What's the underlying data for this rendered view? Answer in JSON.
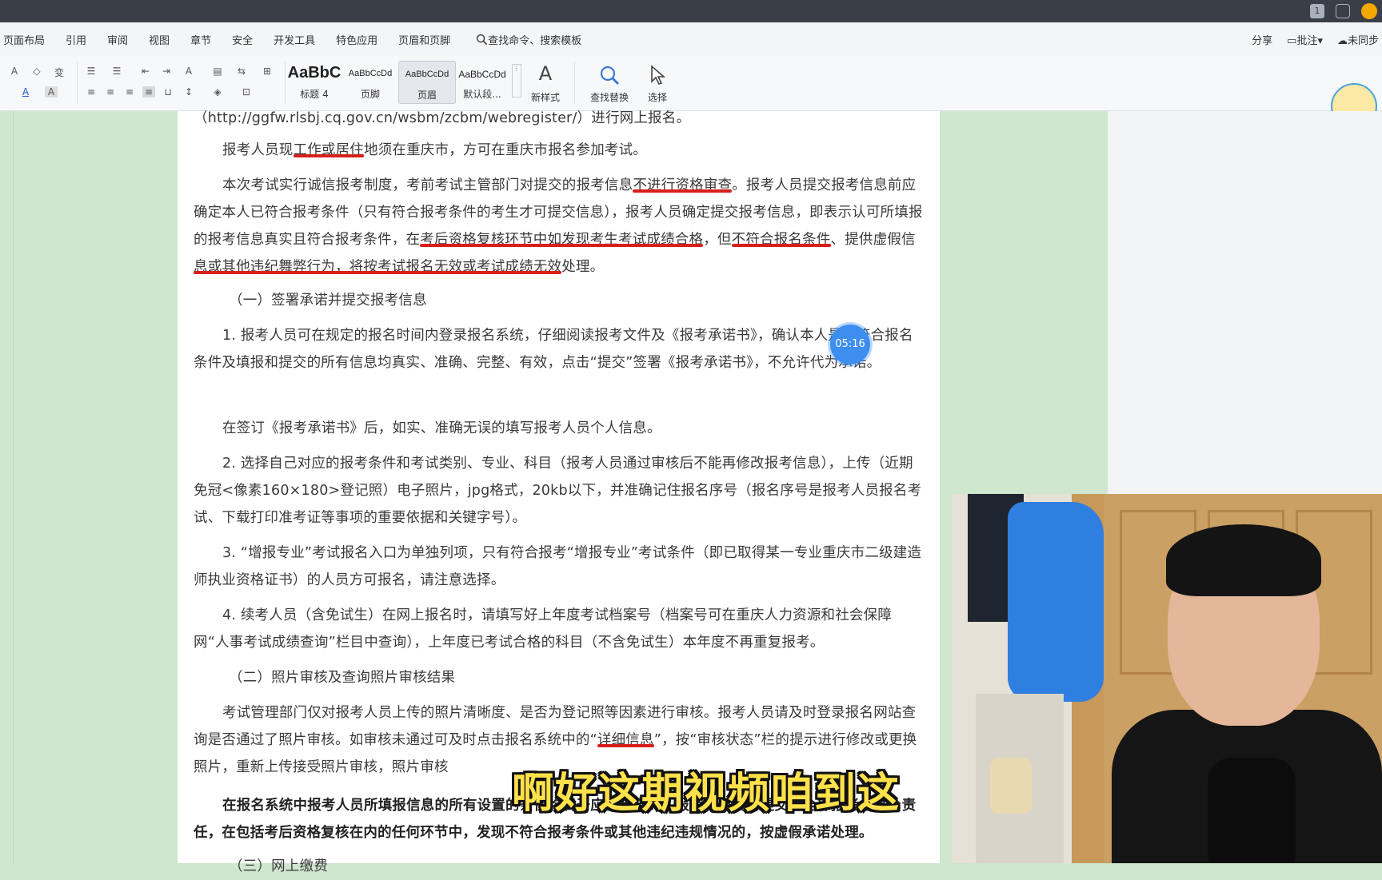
{
  "titlebar": {
    "badge": "1"
  },
  "menu": {
    "items": [
      "页面布局",
      "引用",
      "审阅",
      "视图",
      "章节",
      "安全",
      "开发工具",
      "特色应用",
      "页眉和页脚"
    ],
    "search": "查找命令、搜索模板",
    "right": [
      "分享",
      "批注",
      "未同步"
    ]
  },
  "ribbon": {
    "styles": [
      {
        "sample": "AaBbC",
        "label": "标题 4"
      },
      {
        "sample": "AaBbCcDd",
        "label": "页脚"
      },
      {
        "sample": "AaBbCcDd",
        "label": "页眉"
      },
      {
        "sample": "AaBbCcDd",
        "label": "默认段..."
      }
    ],
    "new_style": "新样式",
    "find_replace": "查找替换",
    "select": "选择"
  },
  "timer": "05:16",
  "doc": {
    "line_url": "（http://ggfw.rlsbj.cq.gov.cn/wsbm/zcbm/webregister/）进行网上报名。",
    "p1": {
      "a": "报考人员现",
      "u": "工作或居住",
      "b": "地须在重庆市，方可在重庆市报名参加考试。"
    },
    "p2": {
      "a": "本次考试实行诚信报考制度，考前考试主管部门对提交的报考信息",
      "u1": "不进行资格审查",
      "b": "。报考人员提交报考信息前应确定本人已符合报考条件（只有符合报考条件的考生才可提交信息），报考人员确定提交报考信息，即表示认可所填报的报考信息真实且符合报考条件，在",
      "u2": "考后资格复核环节中如发现考生考试成绩合格",
      "c": "，但",
      "u3": "不符合报名条件",
      "d": "、提供虚假信",
      "u4": "息或其他违纪舞弊行为，将按考试报名无效或考试成绩无效",
      "e": "处理。"
    },
    "h1": "（一）签署承诺并提交报考信息",
    "p3": "1. 报考人员可在规定的报名时间内登录报名系统，仔细阅读报考文件及《报考承诺书》，确认本人是否符合报名条件及填报和提交的所有信息均真实、准确、完整、有效，点击“提交”签署《报考承诺书》，不允许代为承诺。",
    "p4": "在签订《报考承诺书》后，如实、准确无误的填写报考人员个人信息。",
    "p5": "2. 选择自己对应的报考条件和考试类别、专业、科目（报考人员通过审核后不能再修改报考信息），上传（近期免冠<像素160×180>登记照）电子照片，jpg格式，20kb以下，并准确记住报名序号（报名序号是报考人员报名考试、下载打印准考证等事项的重要依据和关键字号）。",
    "p6": "3. “增报专业”考试报名入口为单独列项，只有符合报考“增报专业”考试条件（即已取得某一专业重庆市二级建造师执业资格证书）的人员方可报名，请注意选择。",
    "p7": "4. 续考人员（含免试生）在网上报名时，请填写好上年度考试档案号（档案号可在重庆人力资源和社会保障网“人事考试成绩查询”栏目中查询），上年度已考试合格的科目（不含免试生）本年度不再重复报考。",
    "h2": "（二）照片审核及查询照片审核结果",
    "p8": {
      "a": "考试管理部门仅对报考人员上传的照片清晰度、是否为登记照等因素进行审核。报考人员请及时登录报名网站查询是否通过了照片审核。如审核未通过可及时点击报名系统中的“",
      "u": "详细信息",
      "b": "”，按“审核状态”栏的提示进行修改或更换照片，重新上传接受照片审核，照片审核"
    },
    "p9": "在报名系统中报考人员所填报信息的所有设置的条件均属于应当承诺的，报考人员要对提交的全部报考信息负责任，在包括考后资格复核在内的任何环节中，发现不符合报考条件或其他违纪违规情况的，按虚假承诺处理。",
    "h3": "（三）网上缴费"
  },
  "subtitle": "啊好这期视频咱到这"
}
